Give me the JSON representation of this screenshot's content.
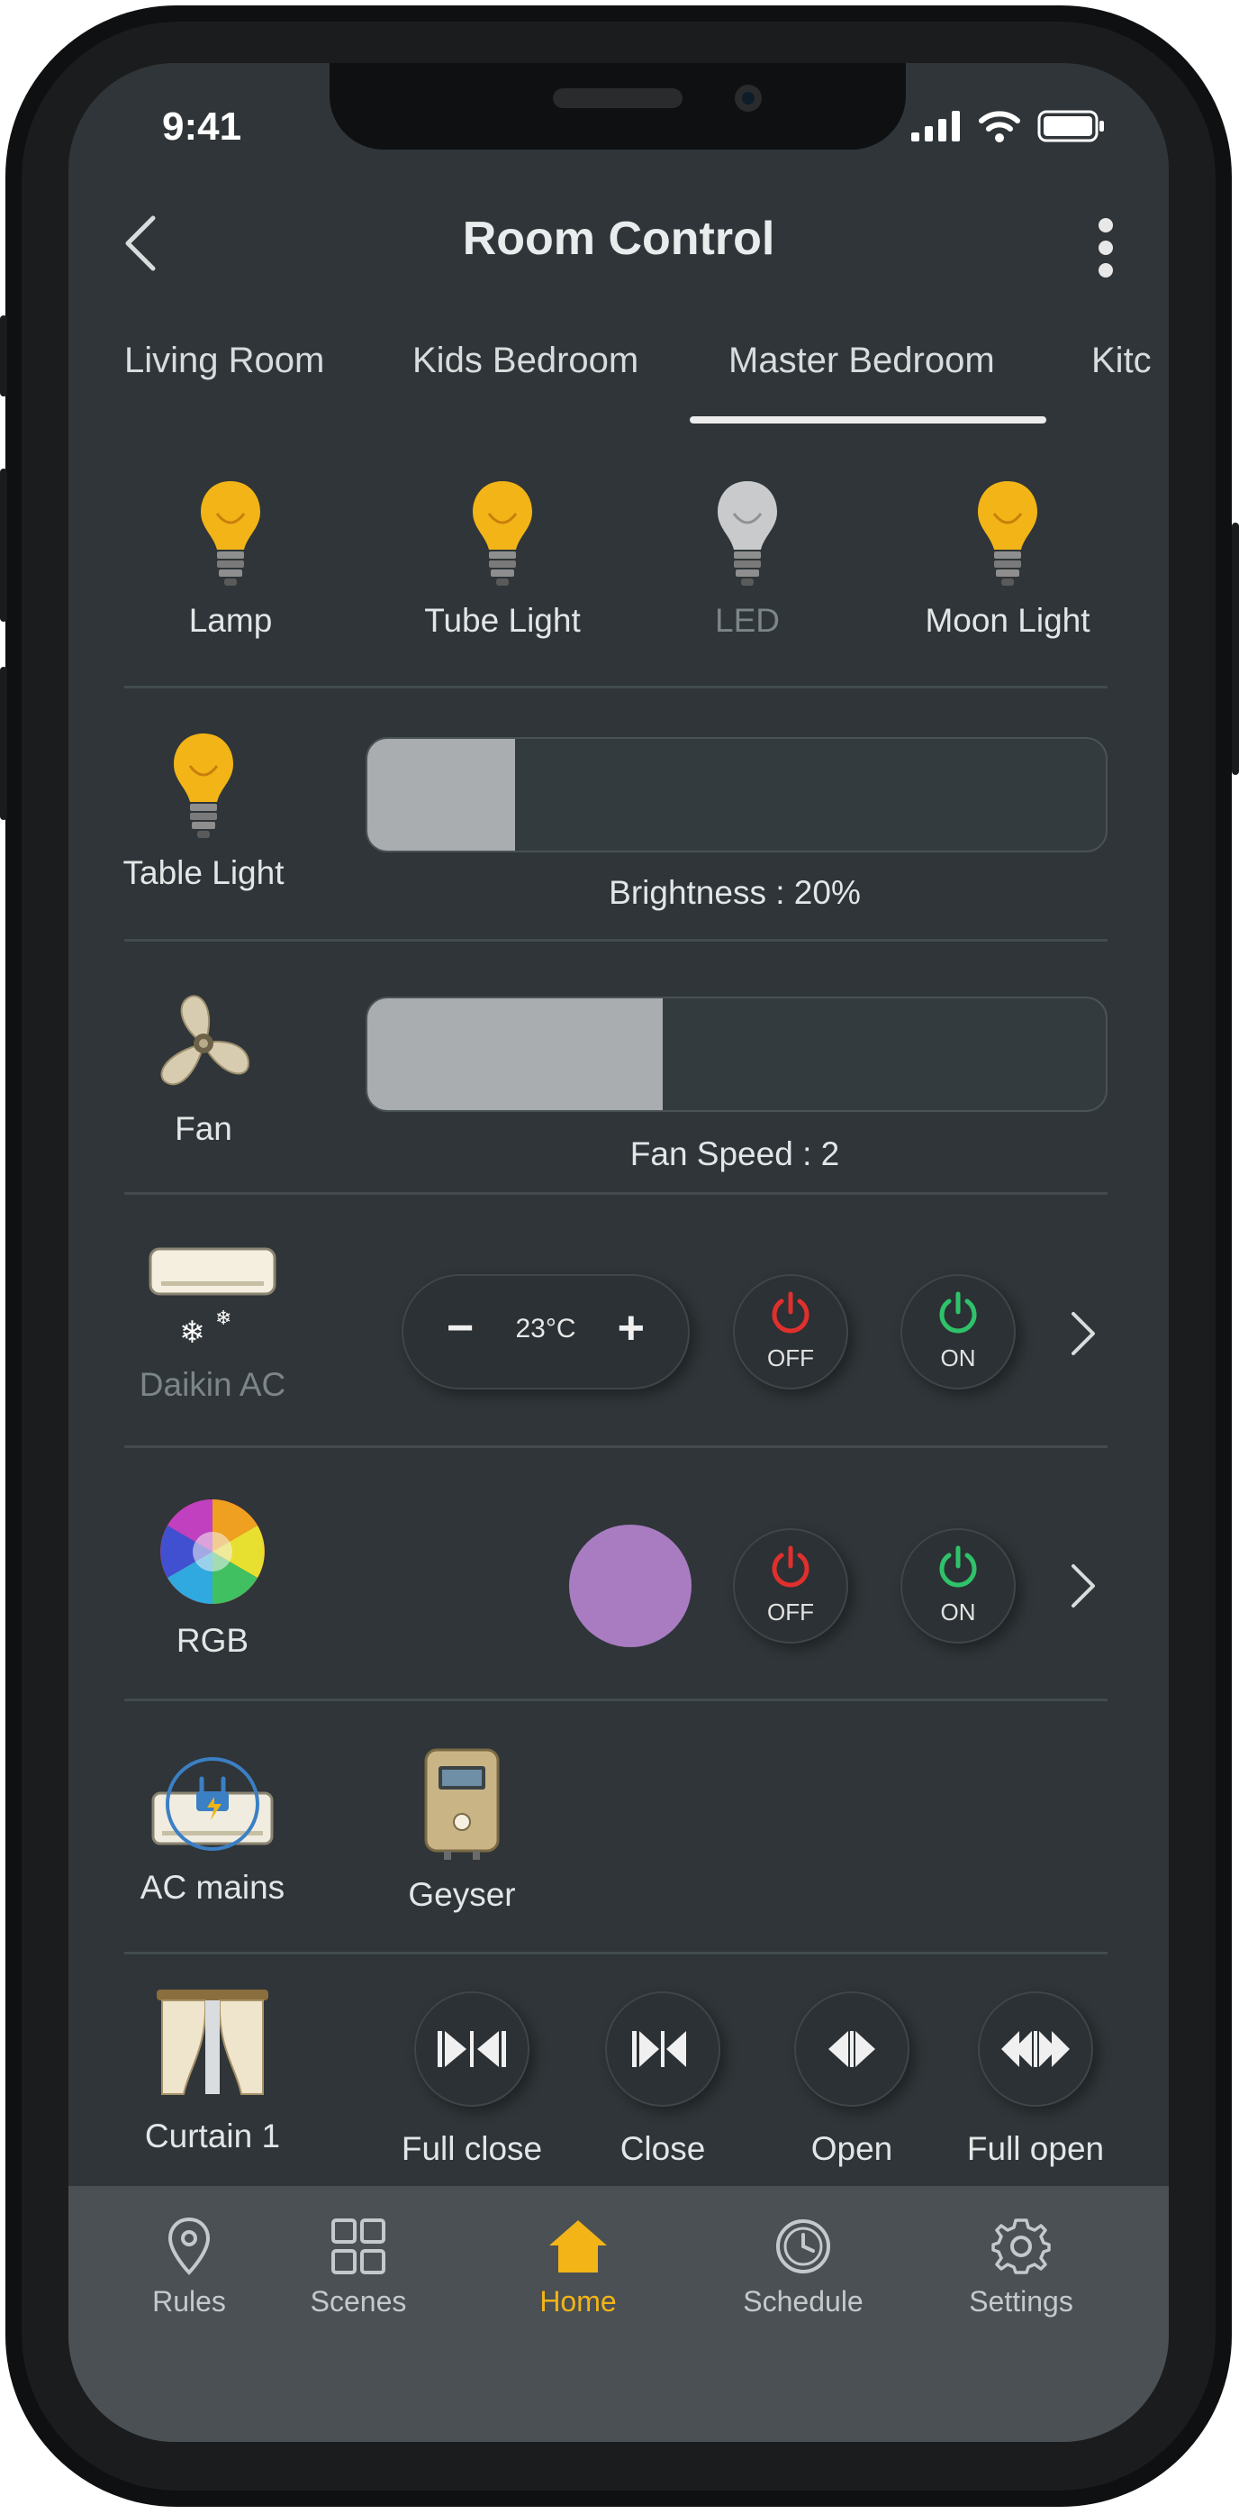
{
  "status": {
    "time": "9:41"
  },
  "header": {
    "title": "Room Control"
  },
  "tabs": [
    {
      "label": "Living Room",
      "active": false
    },
    {
      "label": "Kids Bedroom",
      "active": false
    },
    {
      "label": "Master Bedroom",
      "active": true
    },
    {
      "label": "Kitc",
      "active": false
    }
  ],
  "lights": [
    {
      "label": "Lamp",
      "state": "on"
    },
    {
      "label": "Tube Light",
      "state": "on"
    },
    {
      "label": "LED",
      "state": "off"
    },
    {
      "label": "Moon Light",
      "state": "on"
    }
  ],
  "table_light": {
    "label": "Table Light",
    "brightness_caption": "Brightness : 20%",
    "brightness_fraction": 0.2
  },
  "fan": {
    "label": "Fan",
    "speed_caption": "Fan Speed : 2",
    "speed_fraction": 0.4
  },
  "ac": {
    "label": "Daikin AC",
    "temperature": "23°C",
    "minus": "−",
    "plus": "+",
    "off_label": "OFF",
    "on_label": "ON"
  },
  "rgb": {
    "label": "RGB",
    "color": "#a97cc2",
    "off_label": "OFF",
    "on_label": "ON"
  },
  "appliances": [
    {
      "label": "AC mains"
    },
    {
      "label": "Geyser"
    }
  ],
  "curtain": {
    "label": "Curtain 1",
    "actions": [
      "Full close",
      "Close",
      "Open",
      "Full open"
    ]
  },
  "nav": [
    {
      "label": "Rules",
      "icon": "location-pin-icon",
      "active": false
    },
    {
      "label": "Scenes",
      "icon": "grid-icon",
      "active": false
    },
    {
      "label": "Home",
      "icon": "home-icon",
      "active": true
    },
    {
      "label": "Schedule",
      "icon": "clock-icon",
      "active": false
    },
    {
      "label": "Settings",
      "icon": "gear-icon",
      "active": false
    }
  ],
  "colors": {
    "background": "#2f3538",
    "accent": "#f2b417",
    "off_red": "#e0302d",
    "on_green": "#2fc26a",
    "nav_bg": "#4a5054"
  }
}
